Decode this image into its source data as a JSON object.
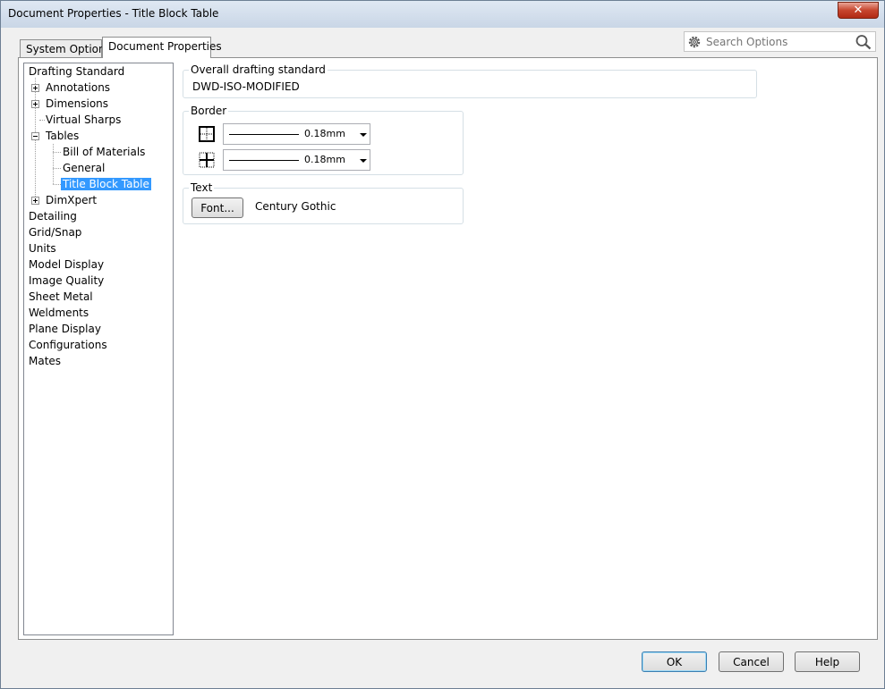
{
  "window": {
    "title": "Document Properties - Title Block Table",
    "close_label": "✕"
  },
  "tabs": {
    "system_options": "System Options",
    "document_properties": "Document Properties"
  },
  "search": {
    "placeholder": "Search Options"
  },
  "tree": {
    "items": [
      {
        "label": "Drafting Standard"
      },
      {
        "label": "Annotations"
      },
      {
        "label": "Dimensions"
      },
      {
        "label": "Virtual Sharps"
      },
      {
        "label": "Tables"
      },
      {
        "label": "Bill of Materials"
      },
      {
        "label": "General"
      },
      {
        "label": "Title Block Table"
      },
      {
        "label": "DimXpert"
      },
      {
        "label": "Detailing"
      },
      {
        "label": "Grid/Snap"
      },
      {
        "label": "Units"
      },
      {
        "label": "Model Display"
      },
      {
        "label": "Image Quality"
      },
      {
        "label": "Sheet Metal"
      },
      {
        "label": "Weldments"
      },
      {
        "label": "Plane Display"
      },
      {
        "label": "Configurations"
      },
      {
        "label": "Mates"
      }
    ],
    "selected": "Title Block Table"
  },
  "overall": {
    "label": "Overall drafting standard",
    "value": "DWD-ISO-MODIFIED"
  },
  "border": {
    "label": "Border",
    "outer_value": "0.18mm",
    "inner_value": "0.18mm"
  },
  "text": {
    "label": "Text",
    "font_button": "Font...",
    "font_name": "Century Gothic"
  },
  "buttons": {
    "ok": "OK",
    "cancel": "Cancel",
    "help": "Help"
  }
}
